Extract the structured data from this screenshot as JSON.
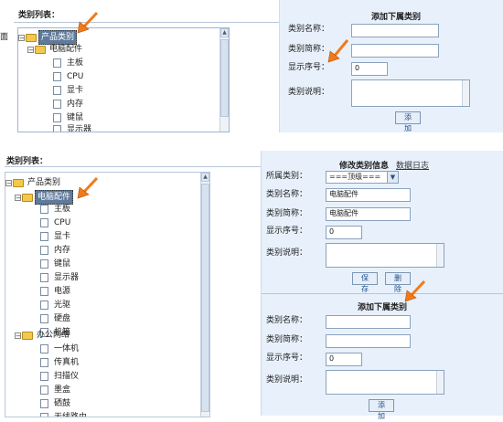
{
  "top": {
    "list_title": "类别列表：",
    "side_text": "面",
    "tree_items": [
      "产品类别",
      "电脑配件",
      "主板",
      "CPU",
      "显卡",
      "内存",
      "键鼠",
      "显示器"
    ],
    "add_title": "添加下属类别",
    "fields": {
      "name": "类别名称：",
      "short": "类别简称：",
      "order": "显示序号：",
      "desc": "类别说明："
    },
    "order_value": "0",
    "add_button": "添加"
  },
  "bottom": {
    "list_title": "类别列表：",
    "tree": {
      "root": "产品类别",
      "group1": "电脑配件",
      "group1_items": [
        "主板",
        "CPU",
        "显卡",
        "内存",
        "键鼠",
        "显示器",
        "电源",
        "光驱",
        "硬盘",
        "机箱"
      ],
      "group2": "办公网络",
      "group2_items": [
        "一体机",
        "传真机",
        "扫描仪",
        "墨盒",
        "硒鼓",
        "无线路由"
      ]
    },
    "edit_title": "修改类别信息",
    "log_link": "数据日志",
    "parent_label": "所属类别：",
    "parent_value": "===顶级===",
    "name_label": "类别名称：",
    "name_value": "电脑配件",
    "short_label": "类别简称：",
    "short_value": "电脑配件",
    "order_label": "显示序号：",
    "order_value": "0",
    "desc_label": "类别说明：",
    "save_button": "保存",
    "delete_button": "删除",
    "add_title": "添加下属类别",
    "add_name_label": "类别名称：",
    "add_short_label": "类别简称：",
    "add_order_label": "显示序号：",
    "add_order_value": "0",
    "add_desc_label": "类别说明：",
    "add_button": "添加"
  },
  "colors": {
    "panel_bg": "#e8f1fb",
    "arrow": "#f07a1a",
    "selected": "#5f7a9a"
  }
}
